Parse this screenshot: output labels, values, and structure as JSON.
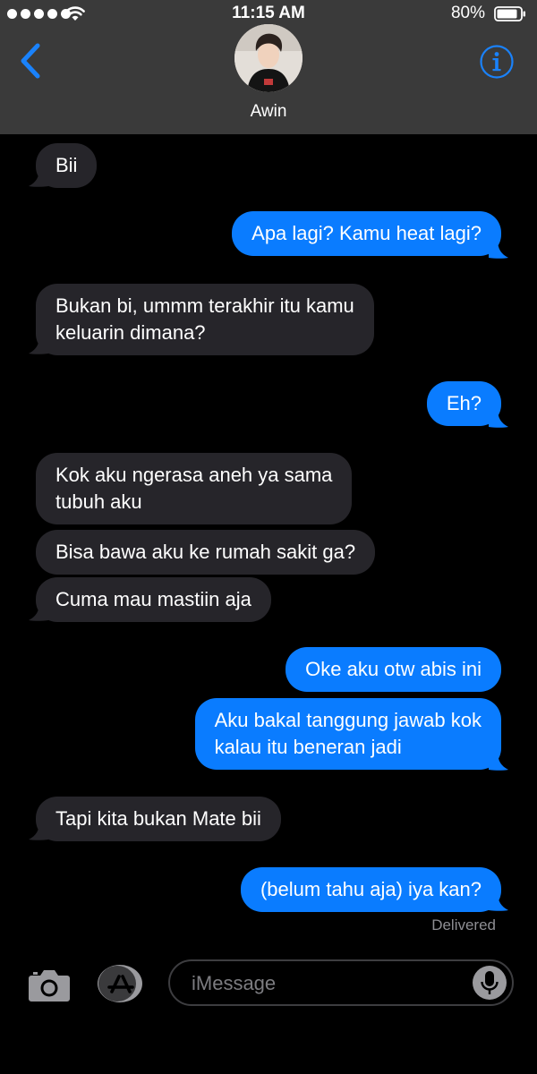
{
  "status_bar": {
    "time": "11:15 AM",
    "battery": "80%"
  },
  "header": {
    "contact_name": "Awin",
    "back_icon": "chevron-left-icon",
    "info_icon": "info-icon"
  },
  "colors": {
    "header_bg": "#3a3a3a",
    "incoming_bubble": "#26252a",
    "outgoing_bubble": "#0a7cff",
    "accent": "#1a82fb"
  },
  "messages": [
    {
      "direction": "in",
      "text": "Bii"
    },
    {
      "direction": "out",
      "text": "Apa lagi? Kamu heat lagi?"
    },
    {
      "direction": "in",
      "lines": [
        "Bukan bi, ummm terakhir itu kamu",
        "keluarin dimana?"
      ]
    },
    {
      "direction": "out",
      "text": "Eh?"
    },
    {
      "direction": "in",
      "lines": [
        "Kok aku ngerasa aneh ya sama",
        "tubuh aku"
      ]
    },
    {
      "direction": "in",
      "text": "Bisa bawa aku ke rumah sakit ga?"
    },
    {
      "direction": "in",
      "text": "Cuma mau mastiin aja"
    },
    {
      "direction": "out",
      "text": "Oke aku otw abis ini"
    },
    {
      "direction": "out",
      "lines": [
        "Aku bakal tanggung jawab kok",
        "kalau itu beneran jadi"
      ]
    },
    {
      "direction": "in",
      "text": "Tapi kita bukan Mate bii"
    },
    {
      "direction": "out",
      "text": "(belum tahu aja) iya kan?"
    }
  ],
  "delivery_status": "Delivered",
  "composer": {
    "placeholder": "iMessage",
    "camera_icon": "camera-icon",
    "appstore_icon": "app-store-icon",
    "mic_icon": "microphone-icon"
  }
}
